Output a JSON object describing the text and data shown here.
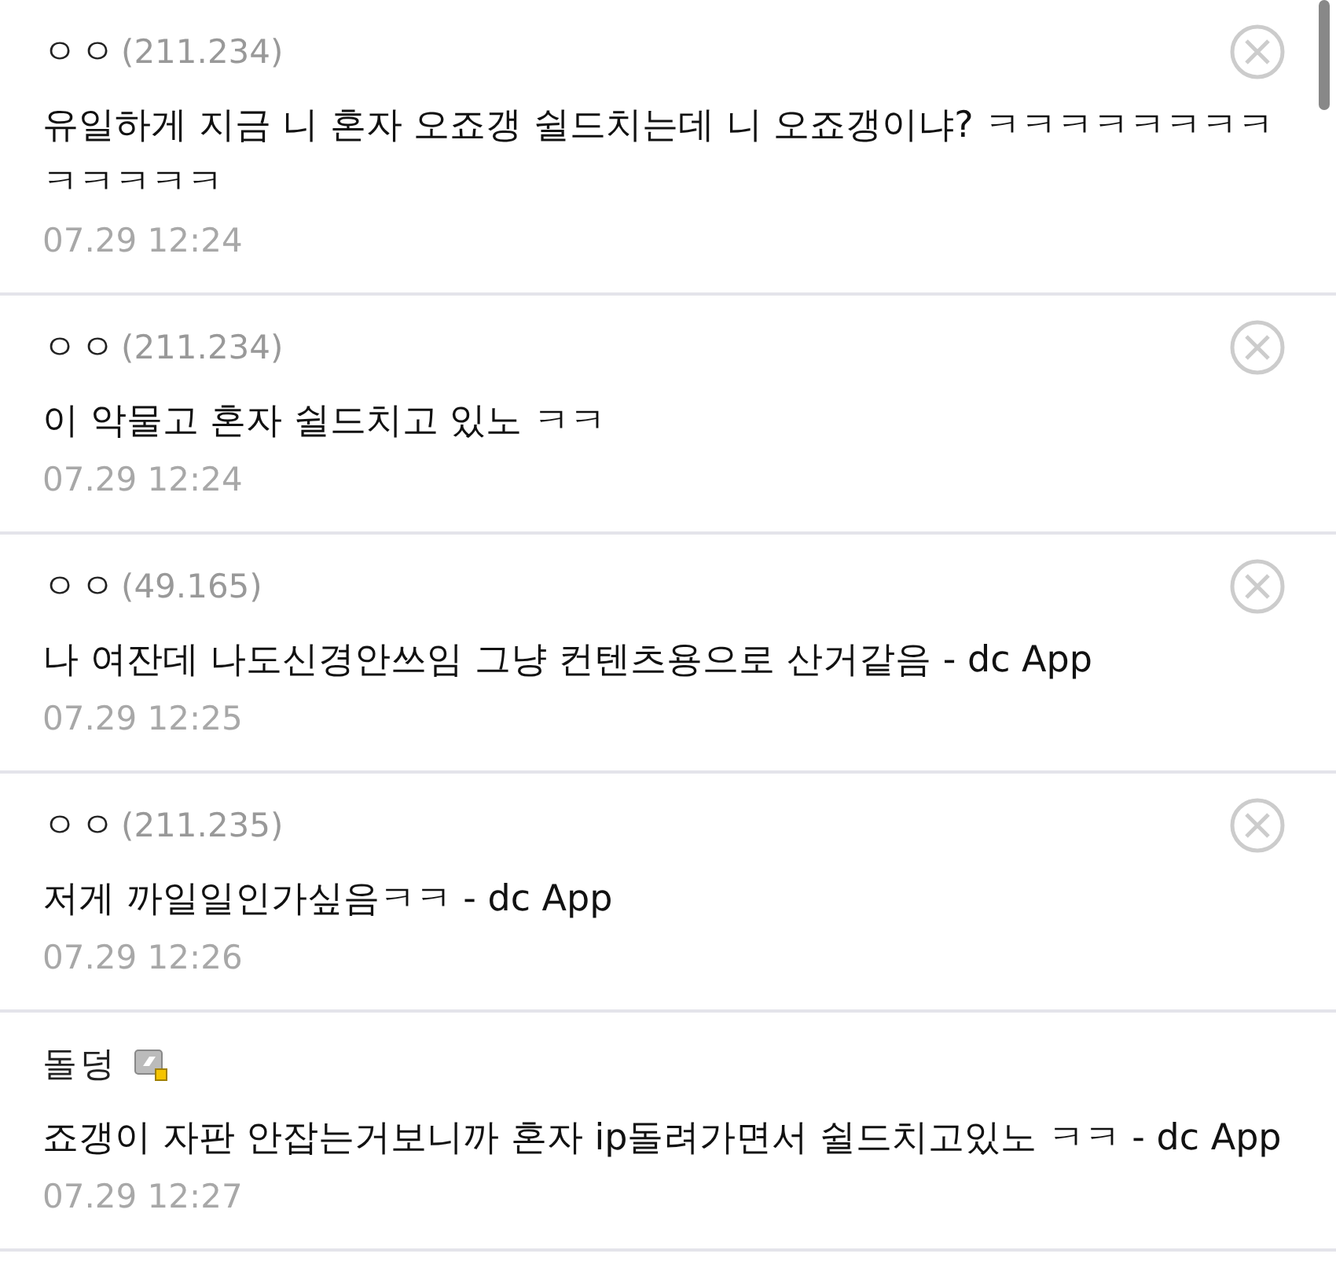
{
  "comments": [
    {
      "author": "ㅇㅇ",
      "ip": "(211.234)",
      "member": false,
      "deletable": true,
      "body": "유일하게 지금 니 혼자 오죠갱 쉴드치는데 니 오죠갱이냐? ㅋㅋㅋㅋㅋㅋㅋㅋㅋㅋㅋㅋㅋ",
      "date": "07.29 12:24"
    },
    {
      "author": "ㅇㅇ",
      "ip": "(211.234)",
      "member": false,
      "deletable": true,
      "body": "이 악물고 혼자 쉴드치고 있노 ㅋㅋ",
      "date": "07.29 12:24"
    },
    {
      "author": "ㅇㅇ",
      "ip": "(49.165)",
      "member": false,
      "deletable": true,
      "body": "나 여잔데 나도신경안쓰임 그냥 컨텐츠용으로 산거같음 - dc App",
      "date": "07.29 12:25"
    },
    {
      "author": "ㅇㅇ",
      "ip": "(211.235)",
      "member": false,
      "deletable": true,
      "body": "저게 까일일인가싶음ㅋㅋ - dc App",
      "date": "07.29 12:26"
    },
    {
      "author": "돌덩",
      "member": true,
      "deletable": false,
      "body": "죠갱이 자판 안잡는거보니까 혼자 ip돌려가면서 쉴드치고있노 ㅋㅋ - dc App",
      "date": "07.29 12:27"
    }
  ]
}
